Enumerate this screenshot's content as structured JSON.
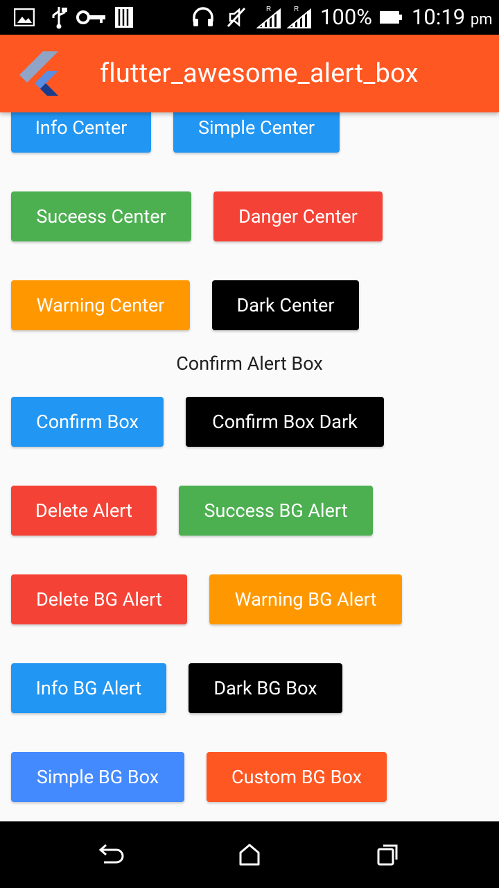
{
  "status_bar": {
    "battery_percent": "100%",
    "time": "10:19",
    "time_suffix": "pm",
    "icons": [
      "gallery-icon",
      "usb-icon",
      "key-icon",
      "storage-icon",
      "headset-icon",
      "mute-icon",
      "signal-r-icon",
      "signal-r-icon",
      "battery-icon"
    ]
  },
  "app_bar": {
    "title": "flutter_awesome_alert_box",
    "logo": "flutter-logo-icon",
    "color": "#ff5722"
  },
  "section_confirm": {
    "title": "Confirm Alert Box"
  },
  "buttons": {
    "info_center": {
      "label": "Info Center",
      "color": "#2196f3"
    },
    "simple_center": {
      "label": "Simple Center",
      "color": "#2196f3"
    },
    "success_center": {
      "label": "Suceess Center",
      "color": "#4caf50"
    },
    "danger_center": {
      "label": "Danger Center",
      "color": "#f44336"
    },
    "warning_center": {
      "label": "Warning Center",
      "color": "#ff9800"
    },
    "dark_center": {
      "label": "Dark Center",
      "color": "#000000"
    },
    "confirm_box": {
      "label": "Confirm Box",
      "color": "#2196f3"
    },
    "confirm_box_dark": {
      "label": "Confirm Box Dark",
      "color": "#000000"
    },
    "delete_alert": {
      "label": "Delete Alert",
      "color": "#f44336"
    },
    "success_bg_alert": {
      "label": "Success BG Alert",
      "color": "#4caf50"
    },
    "delete_bg_alert": {
      "label": "Delete BG Alert",
      "color": "#f44336"
    },
    "warning_bg_alert": {
      "label": "Warning BG Alert",
      "color": "#ff9800"
    },
    "info_bg_alert": {
      "label": "Info BG Alert",
      "color": "#2196f3"
    },
    "dark_bg_box": {
      "label": "Dark BG Box",
      "color": "#000000"
    },
    "simple_bg_box": {
      "label": "Simple BG Box",
      "color": "#448aff"
    },
    "custom_bg_box": {
      "label": "Custom BG Box",
      "color": "#ff5722"
    }
  },
  "nav_bar": {
    "icons": [
      "back-icon",
      "home-icon",
      "recents-icon"
    ]
  }
}
